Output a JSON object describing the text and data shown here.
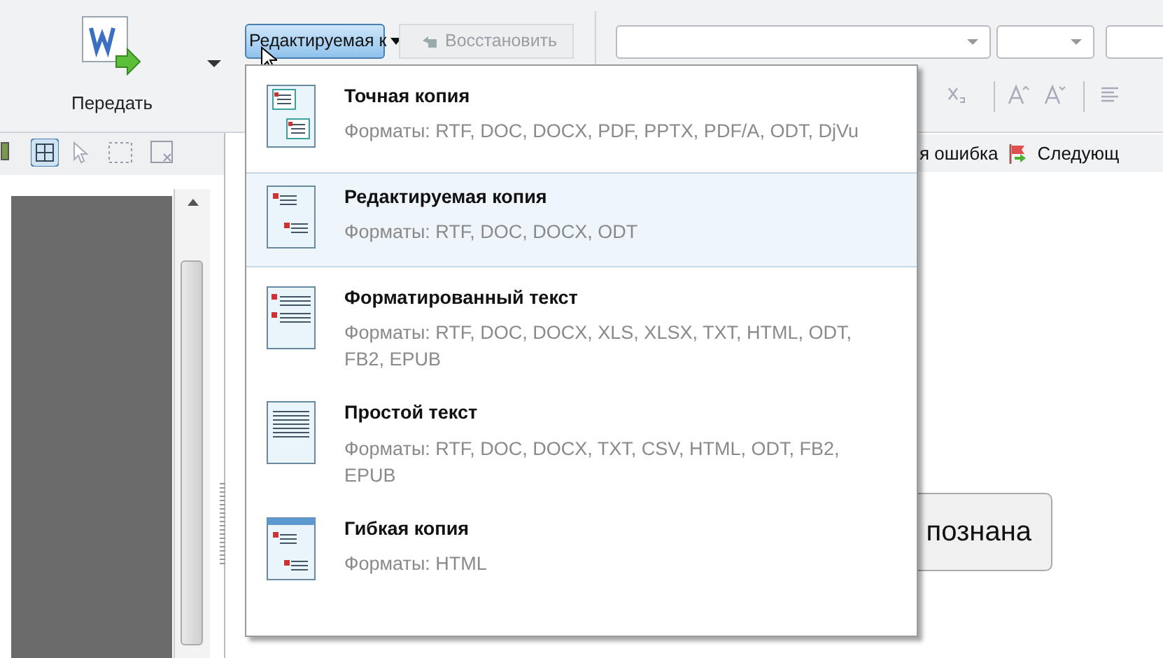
{
  "toolbar": {
    "send_button": {
      "label": "Передать"
    },
    "format_dropdown": {
      "value": "Редактируемая к"
    },
    "restore_button": {
      "label": "Восстановить",
      "disabled": true
    }
  },
  "format_menu": {
    "items": [
      {
        "kind": "exact",
        "title": "Точная копия",
        "formats": "Форматы: RTF, DOC, DOCX, PDF, PPTX, PDF/A, ODT, DjVu",
        "selected": false
      },
      {
        "kind": "editable",
        "title": "Редактируемая копия",
        "formats": "Форматы: RTF, DOC, DOCX, ODT",
        "selected": true
      },
      {
        "kind": "formatted",
        "title": "Форматированный текст",
        "formats": "Форматы: RTF, DOC, DOCX, XLS, XLSX, TXT, HTML, ODT, FB2, EPUB",
        "selected": false
      },
      {
        "kind": "plain",
        "title": "Простой текст",
        "formats": "Форматы: RTF, DOC, DOCX, TXT, CSV, HTML, ODT, FB2, EPUB",
        "selected": false
      },
      {
        "kind": "flexible",
        "title": "Гибкая копия",
        "formats": "Форматы: HTML",
        "selected": false
      }
    ]
  },
  "error_bar": {
    "previous_label": "я ошибка",
    "next_label": "Следующ"
  },
  "document": {
    "status_button": "познана"
  }
}
